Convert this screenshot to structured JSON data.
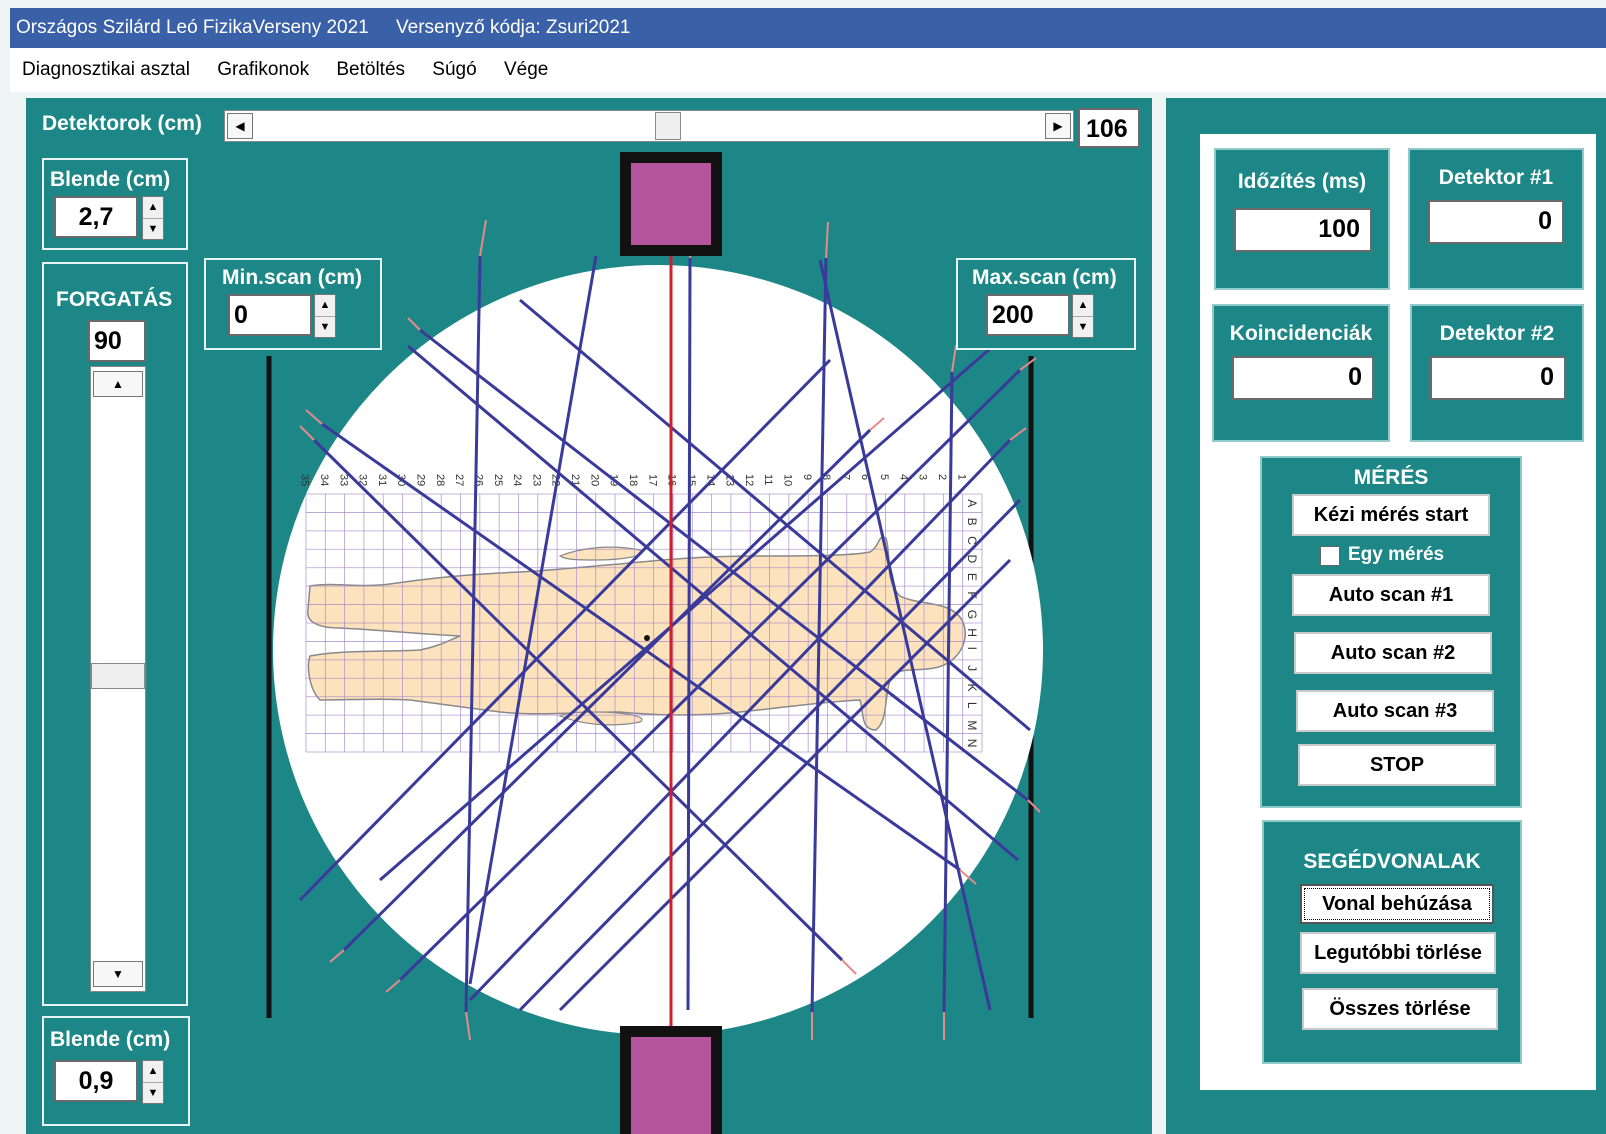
{
  "window": {
    "title": "Országos Szilárd Leó FizikaVerseny 2021",
    "contestant_code": "Versenyző kódja: Zsuri2021"
  },
  "menu": [
    "Diagnosztikai asztal",
    "Grafikonok",
    "Betöltés",
    "Súgó",
    "Vége"
  ],
  "detectors": {
    "label": "Detektorok (cm)",
    "value": "106"
  },
  "blende_top": {
    "label": "Blende (cm)",
    "value": "2,7"
  },
  "forgatas": {
    "label": "FORGATÁS",
    "value": "90"
  },
  "blende_bottom": {
    "label": "Blende (cm)",
    "value": "0,9"
  },
  "min_scan": {
    "label": "Min.scan (cm)",
    "value": "0"
  },
  "max_scan": {
    "label": "Max.scan (cm)",
    "value": "200"
  },
  "grid": {
    "columns": [
      "35",
      "34",
      "33",
      "32",
      "31",
      "30",
      "29",
      "28",
      "27",
      "26",
      "25",
      "24",
      "23",
      "22",
      "21",
      "20",
      "19",
      "18",
      "17",
      "16",
      "15",
      "14",
      "13",
      "12",
      "11",
      "10",
      "9",
      "8",
      "7",
      "6",
      "5",
      "4",
      "3",
      "2",
      "1"
    ],
    "rows": [
      "A",
      "B",
      "C",
      "D",
      "E",
      "F",
      "G",
      "H",
      "I",
      "J",
      "K",
      "L",
      "M",
      "N"
    ]
  },
  "right_panel": {
    "idozites": {
      "label": "Időzítés (ms)",
      "value": "100"
    },
    "detektor1": {
      "label": "Detektor #1",
      "value": "0"
    },
    "koincidenciak": {
      "label": "Koincidenciák",
      "value": "0"
    },
    "detektor2": {
      "label": "Detektor #2",
      "value": "0"
    },
    "meres": {
      "title": "MÉRÉS",
      "manual_start": "Kézi mérés start",
      "single_label": "Egy mérés",
      "auto1": "Auto scan #1",
      "auto2": "Auto scan #2",
      "auto3": "Auto scan #3",
      "stop": "STOP"
    },
    "segedvonalak": {
      "title": "SEGÉDVONALAK",
      "draw": "Vonal behúzása",
      "delete_last": "Legutóbbi törlése",
      "delete_all": "Összes törlése"
    }
  },
  "colors": {
    "teal": "#1d8787",
    "titlebar": "#3a60a8",
    "detector": "#b4549c",
    "scan_line": "#3a3a9a",
    "axis_line": "#d01f2a",
    "body_fill": "#fde3bd",
    "grid_line": "#a286c9"
  }
}
